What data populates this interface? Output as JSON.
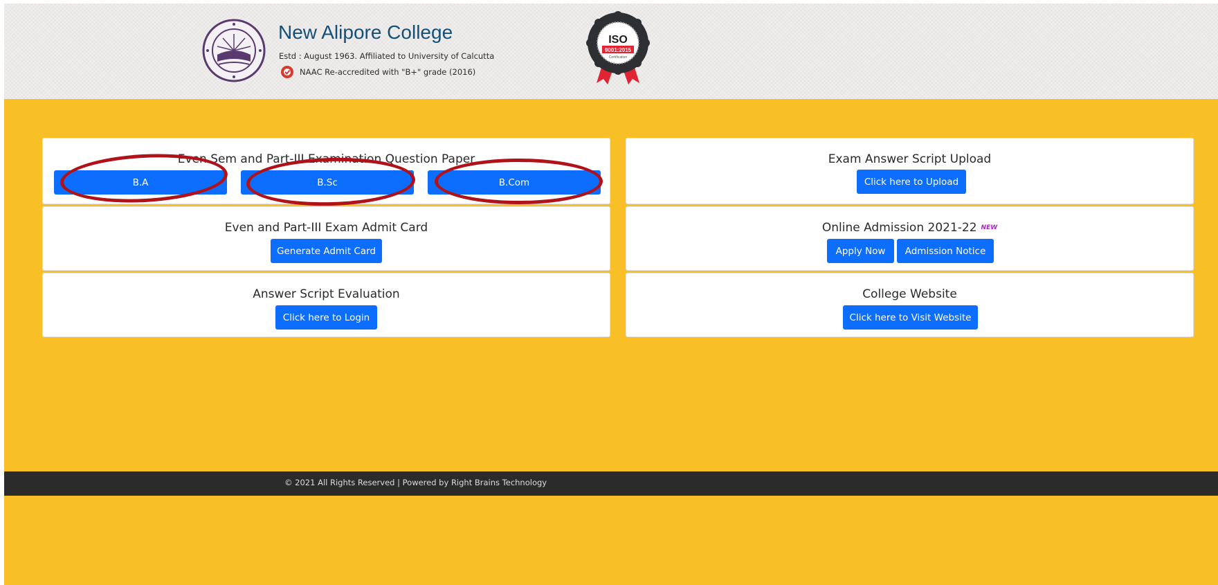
{
  "header": {
    "college_name": "New Alipore College",
    "estd_line": "Estd : August 1963. Affiliated to University of Calcutta",
    "naac_line": "NAAC Re-accredited with \"B+\" grade (2016)",
    "iso_badge": {
      "top": "ISO",
      "middle": "9001:2015",
      "bottom": "Certification"
    }
  },
  "cards": {
    "question_paper": {
      "title": "Even Sem and Part-III Examination Question Paper",
      "buttons": [
        "B.A",
        "B.Sc",
        "B.Com"
      ]
    },
    "answer_upload": {
      "title": "Exam Answer Script Upload",
      "button": "Click here to Upload"
    },
    "admit_card": {
      "title": "Even and Part-III Exam Admit Card",
      "button": "Generate Admit Card"
    },
    "admission": {
      "title": "Online Admission 2021-22",
      "badge": "NEW",
      "buttons": [
        "Apply Now",
        "Admission Notice"
      ]
    },
    "evaluation": {
      "title": "Answer Script Evaluation",
      "button": "Click here to Login"
    },
    "website": {
      "title": "College Website",
      "button": "Click here to Visit Website"
    }
  },
  "footer": {
    "text": "© 2021 All Rights Reserved | Powered by Right Brains Technology"
  },
  "colors": {
    "background": "#f8bf26",
    "primary_button": "#0d6efd",
    "footer": "#2b2b2b",
    "title": "#144f7a",
    "annotation_ring": "#b0121a"
  }
}
